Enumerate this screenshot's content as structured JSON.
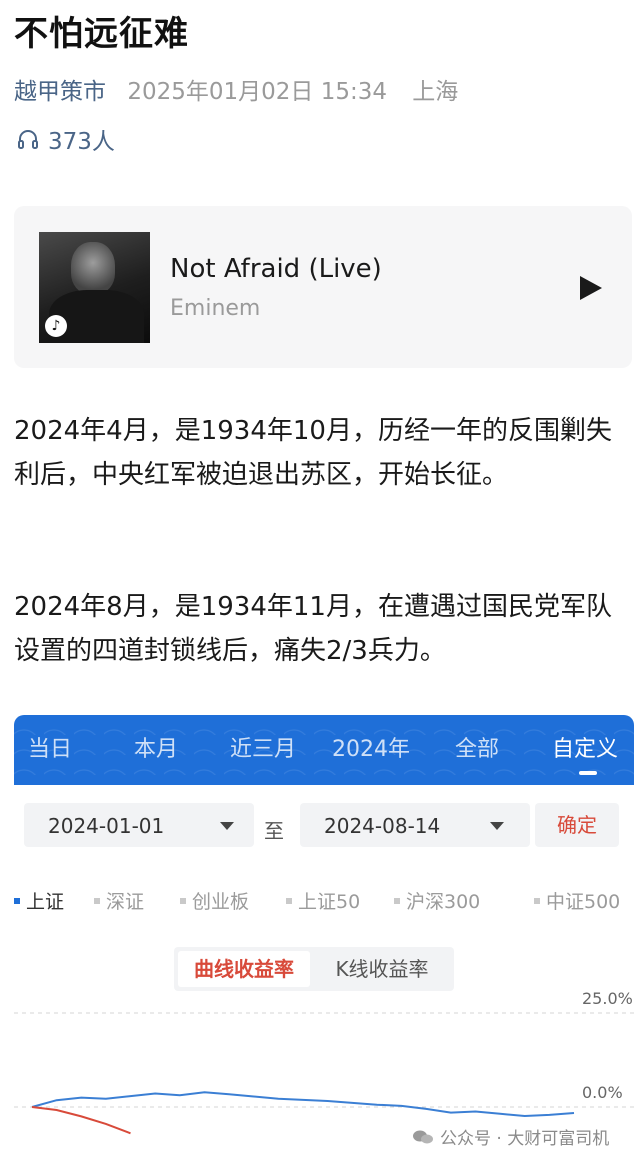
{
  "article": {
    "title": "不怕远征难",
    "author": "越甲策市",
    "date": "2025年01月02日 15:34",
    "location": "上海",
    "listen_count": "373人",
    "paragraph1": "2024年4月，是1934年10月，历经一年的反围剿失利后，中央红军被迫退出苏区，开始长征。",
    "paragraph2": "2024年8月，是1934年11月，在遭遇过国民党军队设置的四道封锁线后，痛失2/3兵力。"
  },
  "music": {
    "title": "Not Afraid (Live)",
    "artist": "Eminem",
    "icon": "play-icon"
  },
  "screenshot": {
    "tabs": [
      "当日",
      "本月",
      "近三月",
      "2024年",
      "全部",
      "自定义"
    ],
    "active_tab": "自定义",
    "start_date": "2024-01-01",
    "to_label": "至",
    "end_date": "2024-08-14",
    "confirm_label": "确定",
    "legends": [
      "上证",
      "深证",
      "创业板",
      "上证50",
      "沪深300",
      "中证500"
    ],
    "active_legend": "上证",
    "segments": [
      "曲线收益率",
      "K线收益率"
    ],
    "active_segment": "曲线收益率",
    "colors": {
      "accent": "#1f6fd8",
      "red": "#d84a3a",
      "blue_line": "#3b7fd4"
    }
  },
  "watermark": "公众号 · 大财可富司机",
  "chart_data": {
    "type": "line",
    "title": "",
    "xlabel": "",
    "ylabel": "",
    "y_tick_labels": [
      "25.0%",
      "0.0%"
    ],
    "ylim": [
      -8,
      25
    ],
    "series": [
      {
        "color": "#3b7fd4",
        "values": [
          0.0,
          1.8,
          2.5,
          2.2,
          2.9,
          3.6,
          3.1,
          3.9,
          3.4,
          2.8,
          2.2,
          1.9,
          1.6,
          1.1,
          0.6,
          0.3,
          -0.5,
          -1.5,
          -1.2,
          -1.8,
          -2.4,
          -2.1,
          -1.6
        ]
      },
      {
        "color": "#d84a3a",
        "values": [
          0.0,
          -0.8,
          -2.5,
          -4.5,
          -7.0
        ]
      }
    ]
  }
}
